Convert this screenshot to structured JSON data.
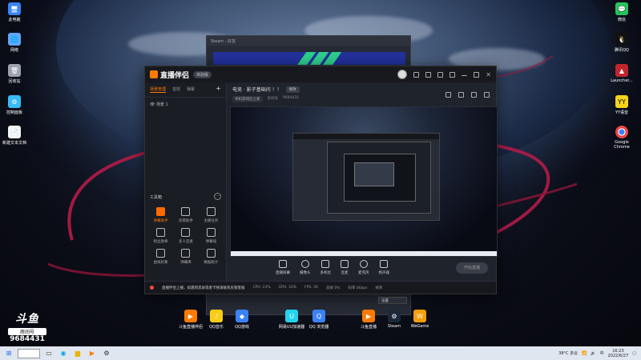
{
  "desktop": {
    "left_icons": [
      {
        "label": "此电脑",
        "icon": "computer-icon",
        "color": "#3b82f6"
      },
      {
        "label": "网络",
        "icon": "network-icon",
        "color": "#60a5fa"
      },
      {
        "label": "回收站",
        "icon": "recycle-bin-icon",
        "color": "#9ca3af"
      },
      {
        "label": "控制面板",
        "icon": "control-panel-icon",
        "color": "#38bdf8"
      },
      {
        "label": "新建文本文档",
        "icon": "text-document-icon",
        "color": "#f5f5f5"
      }
    ],
    "right_icons": [
      {
        "label": "微信",
        "icon": "wechat-icon",
        "color": "#22c55e"
      },
      {
        "label": "腾讯QQ",
        "icon": "qq-icon",
        "color": "#111111"
      },
      {
        "label": "Launcher...",
        "icon": "launcher-icon",
        "color": "#c0262d"
      },
      {
        "label": "YY语音",
        "icon": "yy-icon",
        "color": "#f6d31c"
      },
      {
        "label": "Google Chrome",
        "icon": "chrome-icon",
        "color": "#ef4444"
      }
    ],
    "bottom_icons": [
      {
        "label": "斗鱼直播伴侣",
        "icon": "douyu-companion-icon",
        "color": "#ff7a00"
      },
      {
        "label": "QQ音乐",
        "icon": "qq-music-icon",
        "color": "#facc15"
      },
      {
        "label": "QQ游戏",
        "icon": "qq-game-icon",
        "color": "#3b82f6"
      },
      {
        "label": "网易UU加速器",
        "icon": "uu-accelerator-icon",
        "color": "#22d3ee"
      },
      {
        "label": "QQ 浏览器",
        "icon": "qq-browser-icon",
        "color": "#3b82f6"
      },
      {
        "label": "斗鱼直播",
        "icon": "douyu-live-icon",
        "color": "#ff7a00"
      },
      {
        "label": "Steam",
        "icon": "steam-icon",
        "color": "#1b2838"
      },
      {
        "label": "WeGame",
        "icon": "wegame-icon",
        "color": "#f59e0b"
      }
    ]
  },
  "bg_window": {
    "title": "Steam - 好友"
  },
  "app": {
    "logo_text": "直播伴侣",
    "version": "体验版",
    "tabs": [
      "场景管理",
      "音效",
      "弹幕"
    ],
    "scene_item": "场景 1",
    "toolbox_title": "工具箱",
    "tools": [
      {
        "label": "弹幕助手",
        "active": true
      },
      {
        "label": "房管助手",
        "active": false
      },
      {
        "label": "主播任务",
        "active": false
      },
      {
        "label": "粉丝勋章",
        "active": false
      },
      {
        "label": "多人连麦",
        "active": false
      },
      {
        "label": "弹幕墙",
        "active": false
      },
      {
        "label": "虚拟形象",
        "active": false
      },
      {
        "label": "弹幕库",
        "active": false
      },
      {
        "label": "数据统计",
        "active": false
      }
    ],
    "room_title": "电竞 · 影子基础问 ！！",
    "room_edit": "修改",
    "room_category": "单机游戏区之家",
    "room_id_label": "房间号",
    "room_id": "9684431",
    "controls": [
      {
        "label": "直播屏幕",
        "icon": "screen-icon"
      },
      {
        "label": "摄像头",
        "icon": "camera-icon"
      },
      {
        "label": "多机位",
        "icon": "multi-camera-icon"
      },
      {
        "label": "连麦",
        "icon": "link-mic-icon"
      },
      {
        "label": "麦克风",
        "icon": "microphone-icon"
      },
      {
        "label": "扬声器",
        "icon": "speaker-icon"
      }
    ],
    "go_live": "开始直播",
    "status_notice": "直播伴侣上播，如遇到黑屏或者卡顿请联系房管客服",
    "stats": [
      "CPU: 23%",
      "GPU: 33%",
      "FPS: 30",
      "丢帧 0%",
      "码率 0kbps",
      "帧率"
    ],
    "dropdown": "设置"
  },
  "douyu": {
    "logo": "斗鱼",
    "room_label": "房间号",
    "room_number": "9684431"
  },
  "taskbar": {
    "weather": "38°C 多云",
    "time": "16:23",
    "date": "2022/6/27",
    "lang": "中"
  }
}
